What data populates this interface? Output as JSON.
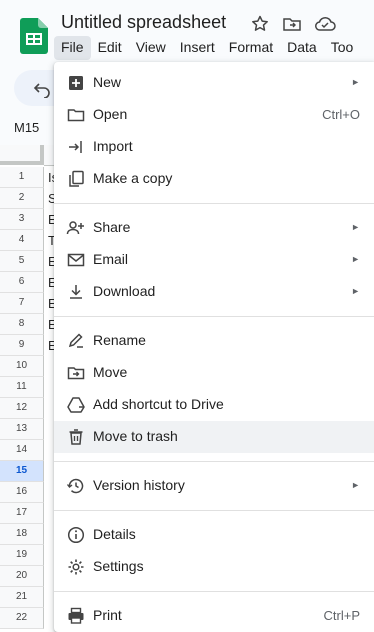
{
  "app": {
    "title": "Untitled spreadsheet",
    "menubar": [
      "File",
      "Edit",
      "View",
      "Insert",
      "Format",
      "Data",
      "Too"
    ]
  },
  "namebox": "M15",
  "rows": [
    {
      "num": "1",
      "cell": "Is"
    },
    {
      "num": "2",
      "cell": "S"
    },
    {
      "num": "3",
      "cell": "E"
    },
    {
      "num": "4",
      "cell": "T"
    },
    {
      "num": "5",
      "cell": "E"
    },
    {
      "num": "6",
      "cell": "E"
    },
    {
      "num": "7",
      "cell": "E"
    },
    {
      "num": "8",
      "cell": "E"
    },
    {
      "num": "9",
      "cell": "E"
    },
    {
      "num": "10",
      "cell": ""
    },
    {
      "num": "11",
      "cell": ""
    },
    {
      "num": "12",
      "cell": ""
    },
    {
      "num": "13",
      "cell": ""
    },
    {
      "num": "14",
      "cell": ""
    },
    {
      "num": "15",
      "cell": ""
    },
    {
      "num": "16",
      "cell": ""
    },
    {
      "num": "17",
      "cell": ""
    },
    {
      "num": "18",
      "cell": ""
    },
    {
      "num": "19",
      "cell": ""
    },
    {
      "num": "20",
      "cell": ""
    },
    {
      "num": "21",
      "cell": ""
    },
    {
      "num": "22",
      "cell": ""
    }
  ],
  "selected_row": "15",
  "file_menu": {
    "new": "New",
    "open": "Open",
    "open_shortcut": "Ctrl+O",
    "import": "Import",
    "make_copy": "Make a copy",
    "share": "Share",
    "email": "Email",
    "download": "Download",
    "rename": "Rename",
    "move": "Move",
    "add_shortcut": "Add shortcut to Drive",
    "move_to_trash": "Move to trash",
    "version_history": "Version history",
    "details": "Details",
    "settings": "Settings",
    "print": "Print",
    "print_shortcut": "Ctrl+P",
    "submenu_arrow": "►"
  },
  "colors": {
    "accent": "#0b57d0",
    "sheets_green": "#0f9d58",
    "menu_hover": "#f0f2f4"
  }
}
